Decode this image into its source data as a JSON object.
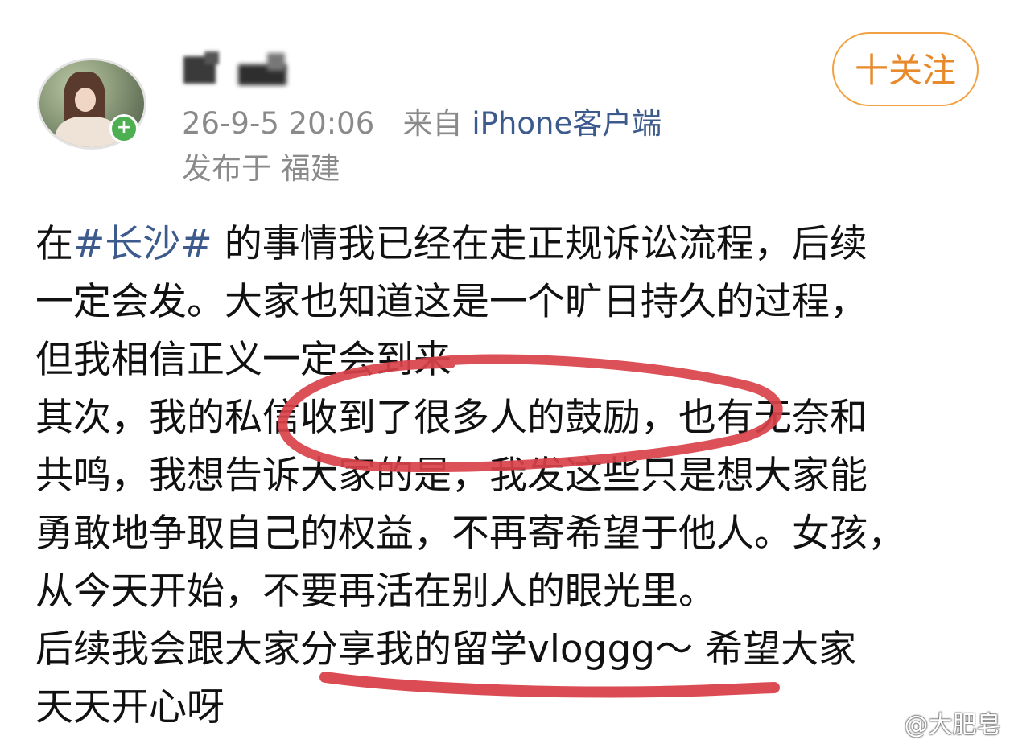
{
  "header": {
    "follow_label": "十关注",
    "timestamp": "26-9-5 20:06",
    "source_prefix": "来自",
    "source_app": "iPhone客户端",
    "location": "发布于 福建"
  },
  "post": {
    "lines": [
      {
        "pre": "在",
        "hashtag": "#长沙#",
        "post": " 的事情我已经在走正规诉讼流程，后续"
      },
      {
        "text": "一定会发。大家也知道这是一个旷日持久的过程，"
      },
      {
        "text": "但我相信正义一定会到来"
      },
      {
        "text": "其次，我的私信收到了很多人的鼓励，也有无奈和"
      },
      {
        "text": "共鸣，我想告诉大家的是，我发这些只是想大家能"
      },
      {
        "text": "勇敢地争取自己的权益，不再寄希望于他人。女孩，"
      },
      {
        "text": "从今天开始，不要再活在别人的眼光里。"
      },
      {
        "text": "后续我会跟大家分享我的留学vloggg～ 希望大家"
      },
      {
        "text": "天天开心呀"
      }
    ]
  },
  "colors": {
    "annotation": "#d9414a",
    "follow_accent": "#e8892b",
    "link": "#3c5a8c",
    "meta": "#8a8a8a"
  },
  "icons": {
    "online_badge": "plus-icon",
    "watermark": "weibo-logo-icon"
  },
  "watermark": {
    "text": "@大肥皂"
  }
}
